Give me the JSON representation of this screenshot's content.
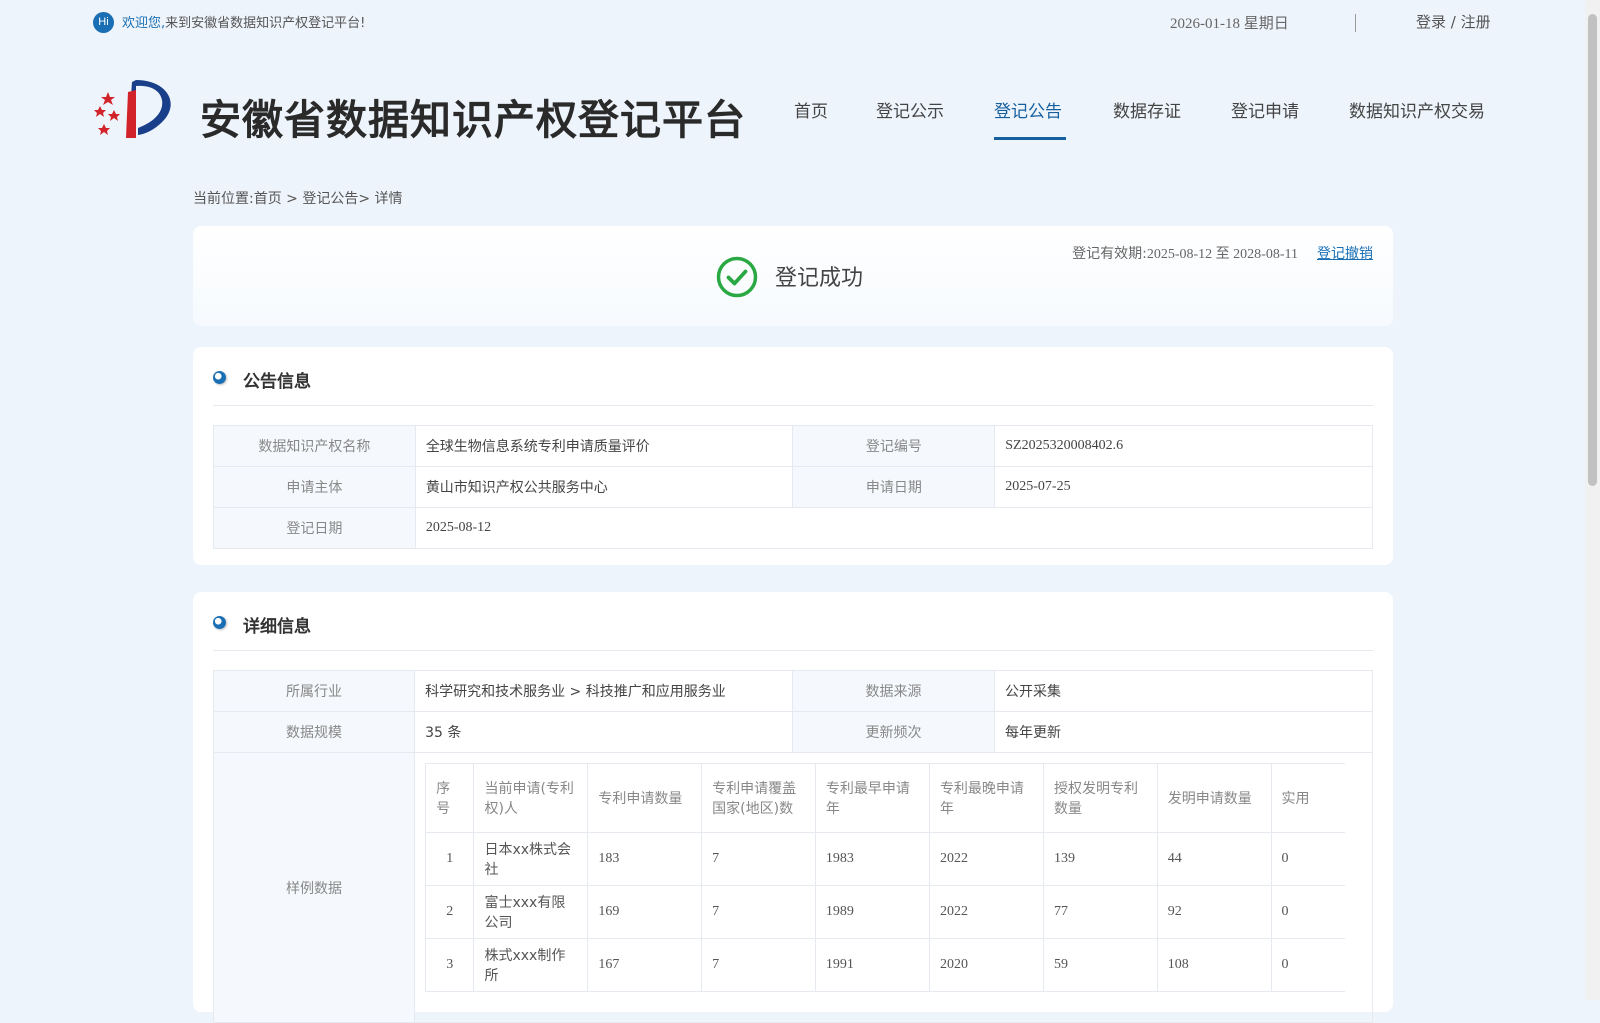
{
  "topbar": {
    "hi_badge": "Hi",
    "welcome_highlight": "欢迎您,",
    "welcome_text": "来到安徽省数据知识产权登记平台!",
    "date": "2026-01-18 星期日",
    "login": "登录",
    "login_sep": " / ",
    "register": "注册"
  },
  "header": {
    "site_title": "安徽省数据知识产权登记平台",
    "nav": [
      "首页",
      "登记公示",
      "登记公告",
      "数据存证",
      "登记申请",
      "数据知识产权交易"
    ],
    "active_nav": "登记公告"
  },
  "breadcrumb": "当前位置:首页 > 登记公告> 详情",
  "status": {
    "text": "登记成功",
    "validity_label": "登记有效期:",
    "validity_dates": "2025-08-12 至 2028-08-11",
    "revoke": "登记撤销",
    "color": "#2aa843"
  },
  "announcement": {
    "title": "公告信息",
    "name_label": "数据知识产权名称",
    "name_value": "全球生物信息系统专利申请质量评价",
    "reg_no_label": "登记编号",
    "reg_no_value": "SZ2025320008402.6",
    "applicant_label": "申请主体",
    "applicant_value": "黄山市知识产权公共服务中心",
    "apply_date_label": "申请日期",
    "apply_date_value": "2025-07-25",
    "reg_date_label": "登记日期",
    "reg_date_value": "2025-08-12"
  },
  "detail": {
    "title": "详细信息",
    "industry_label": "所属行业",
    "industry_value": "科学研究和技术服务业 > 科技推广和应用服务业",
    "source_label": "数据来源",
    "source_value": "公开采集",
    "scale_label": "数据规模",
    "scale_value": "35 条",
    "frequency_label": "更新频次",
    "frequency_value": "每年更新",
    "sample_label": "样例数据",
    "sample_headers": [
      "序号",
      "当前申请(专利权)人",
      "专利申请数量",
      "专利申请覆盖国家(地区)数",
      "专利最早申请年",
      "专利最晚申请年",
      "授权发明专利数量",
      "发明申请数量",
      "实用"
    ],
    "sample_rows": [
      [
        "1",
        "日本xx株式会社",
        "183",
        "7",
        "1983",
        "2022",
        "139",
        "44",
        "0"
      ],
      [
        "2",
        "富士xxx有限公司",
        "169",
        "7",
        "1989",
        "2022",
        "77",
        "92",
        "0"
      ],
      [
        "3",
        "株式xxx制作所",
        "167",
        "7",
        "1991",
        "2020",
        "59",
        "108",
        "0"
      ]
    ]
  },
  "colors": {
    "brand": "#155f9f",
    "background": "#eef4fb"
  }
}
